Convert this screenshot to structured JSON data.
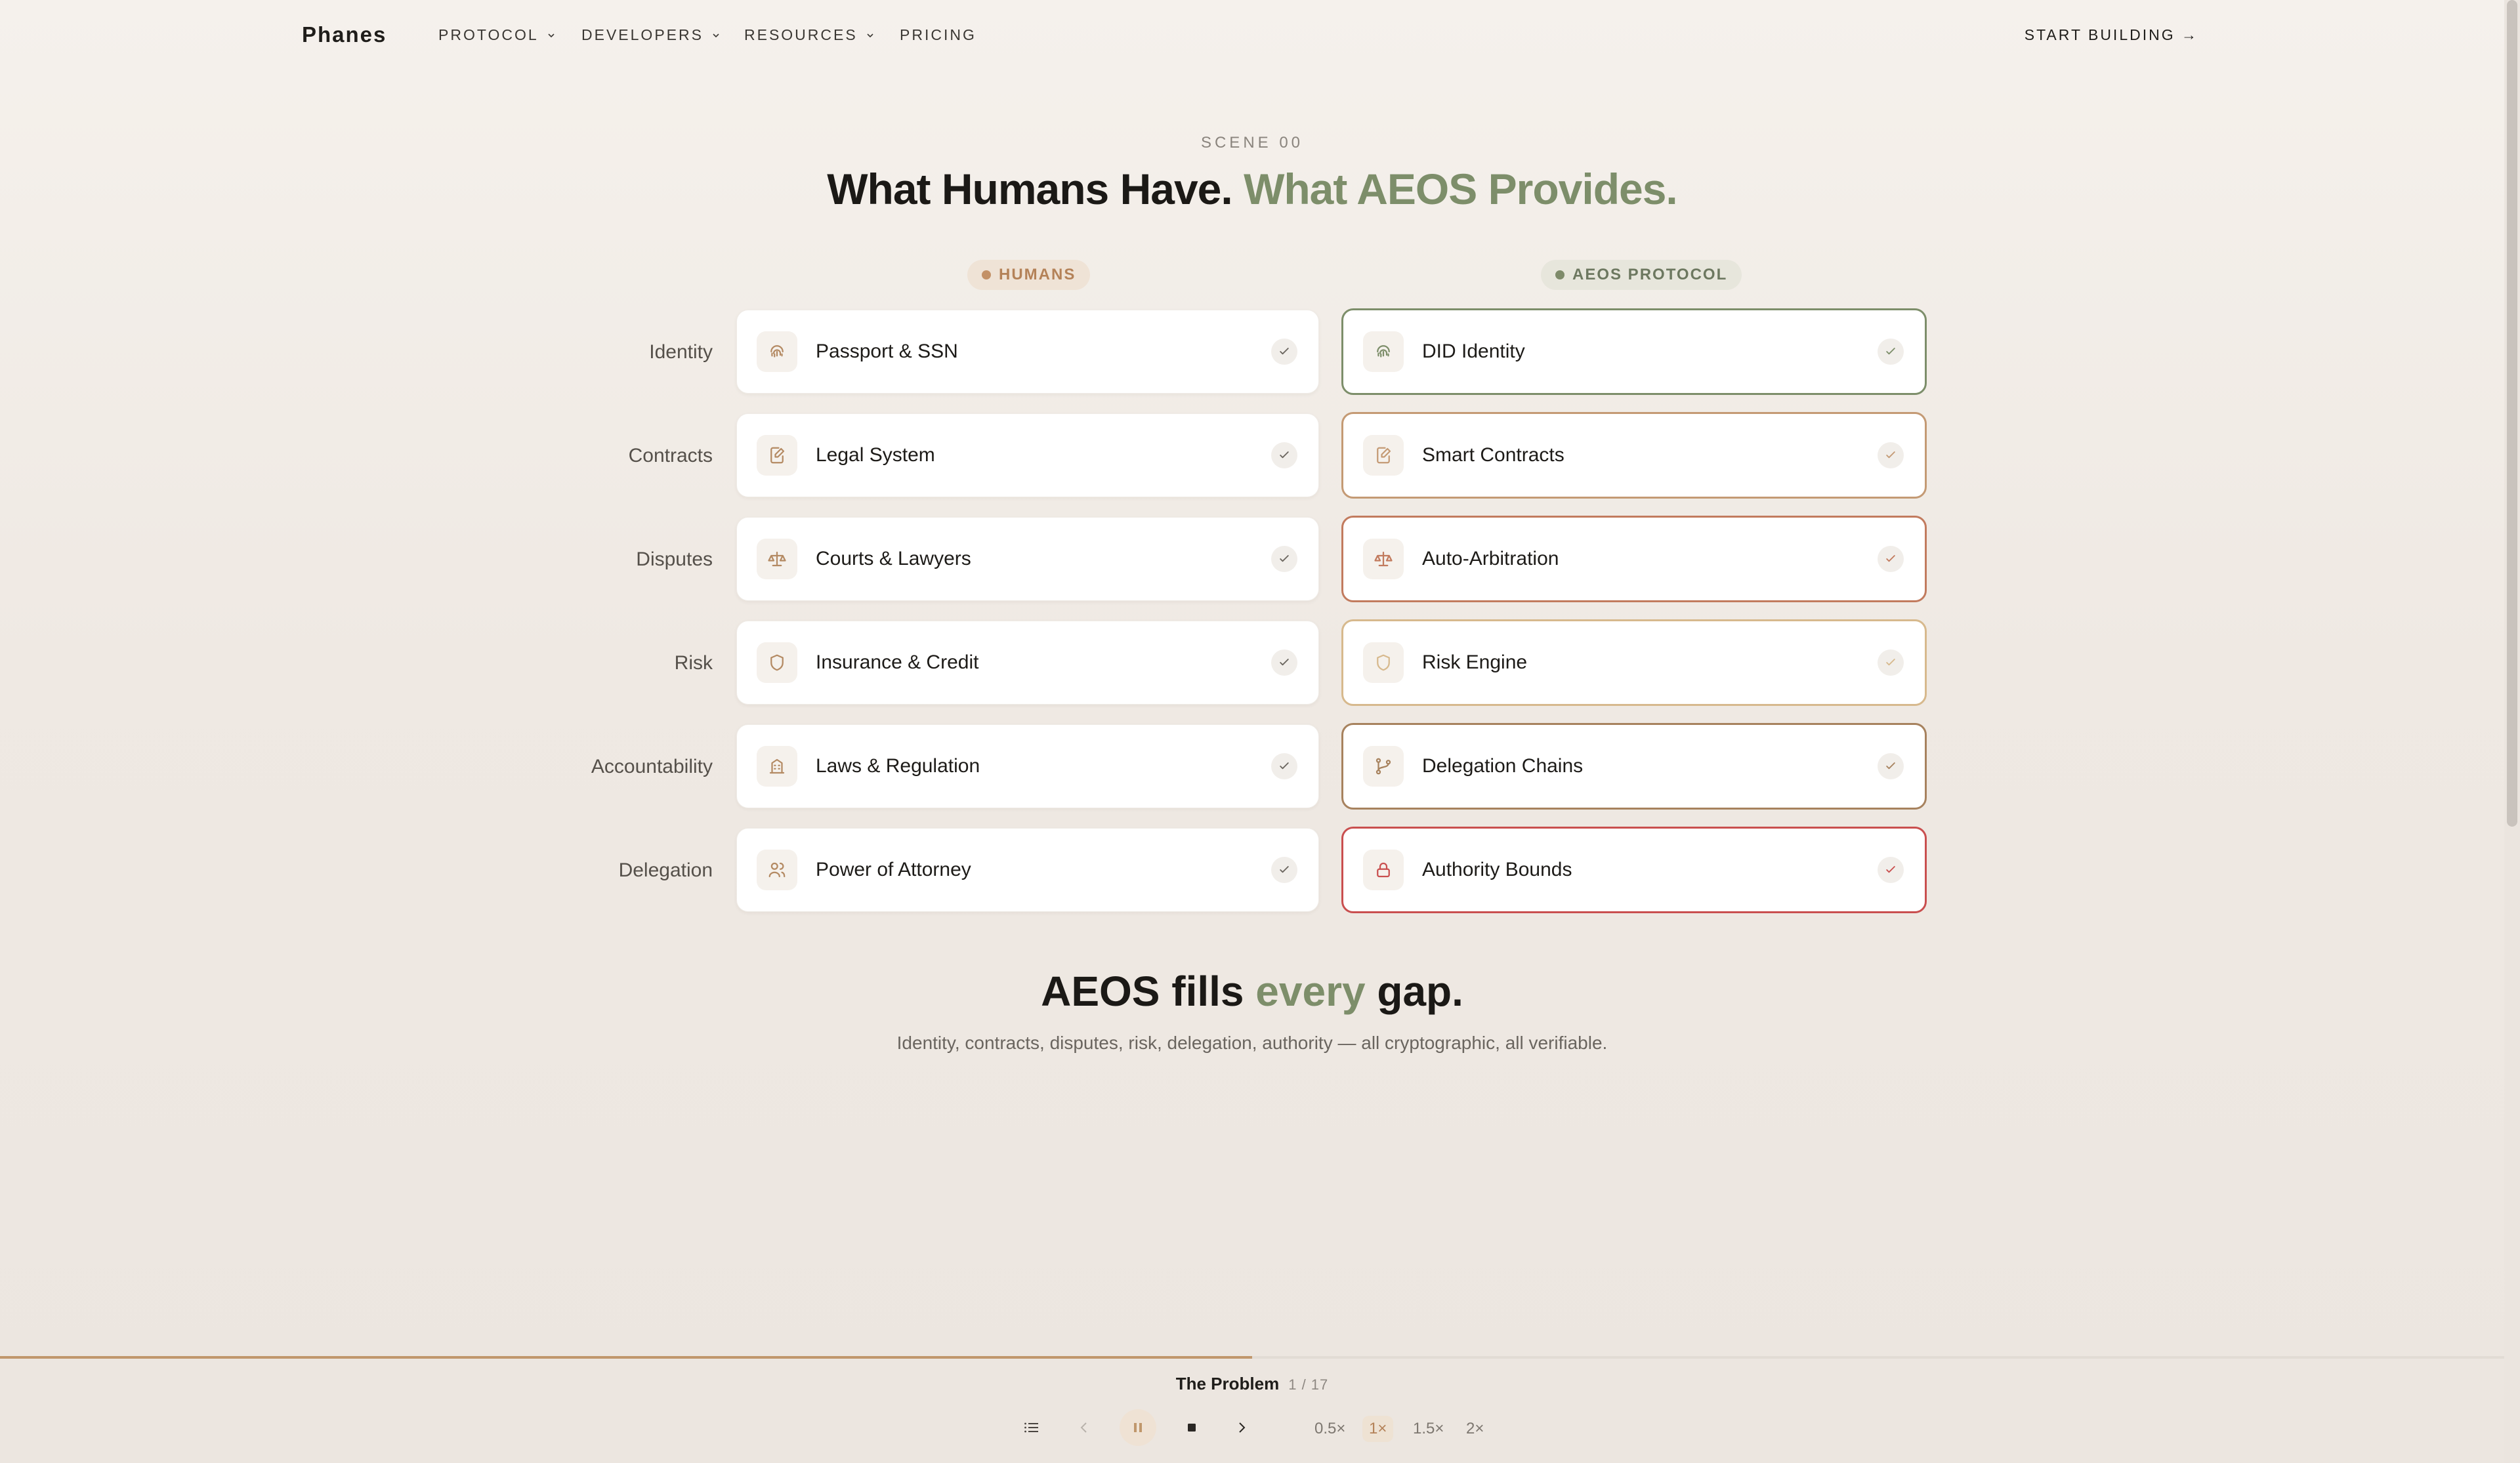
{
  "nav": {
    "logo": "Phanes",
    "items": [
      {
        "label": "PROTOCOL",
        "dropdown": true
      },
      {
        "label": "DEVELOPERS",
        "dropdown": true
      },
      {
        "label": "RESOURCES",
        "dropdown": true
      },
      {
        "label": "PRICING",
        "dropdown": false
      }
    ],
    "cta": "START BUILDING →"
  },
  "header": {
    "eyebrow": "SCENE 00",
    "title_main": "What Humans Have.",
    "title_accent": "What AEOS Provides."
  },
  "columns": {
    "humans": "HUMANS",
    "aeos": "AEOS PROTOCOL"
  },
  "rows": [
    {
      "category": "Identity",
      "human": "Passport & SSN",
      "aeos": "DID Identity",
      "icon": "fingerprint-icon",
      "accent": "#7d8e6a"
    },
    {
      "category": "Contracts",
      "human": "Legal System",
      "aeos": "Smart Contracts",
      "icon": "document-edit-icon",
      "accent": "#c49a74"
    },
    {
      "category": "Disputes",
      "human": "Courts & Lawyers",
      "aeos": "Auto-Arbitration",
      "icon": "scales-icon",
      "accent": "#c27b5e"
    },
    {
      "category": "Risk",
      "human": "Insurance & Credit",
      "aeos": "Risk Engine",
      "icon": "shield-icon",
      "accent": "#d7b98d"
    },
    {
      "category": "Accountability",
      "human": "Laws & Regulation",
      "aeos": "Delegation Chains",
      "icon": "building-icon",
      "aeos_icon": "git-branch-icon",
      "accent": "#a7825e"
    },
    {
      "category": "Delegation",
      "human": "Power of Attorney",
      "aeos": "Authority Bounds",
      "icon": "users-icon",
      "aeos_icon": "lock-icon",
      "accent": "#c94f4f"
    }
  ],
  "summary": {
    "pre": "AEOS fills ",
    "accent": "every",
    "post": " gap.",
    "subtitle": "Identity, contracts, disputes, risk, delegation, authority — all cryptographic, all verifiable."
  },
  "player": {
    "scene_name": "The Problem",
    "scene_count": "1 / 17",
    "progress": 0.5,
    "speeds": [
      "0.5×",
      "1×",
      "1.5×",
      "2×"
    ],
    "active_speed": "1×",
    "colors": {
      "accent": "#c0976c"
    }
  }
}
